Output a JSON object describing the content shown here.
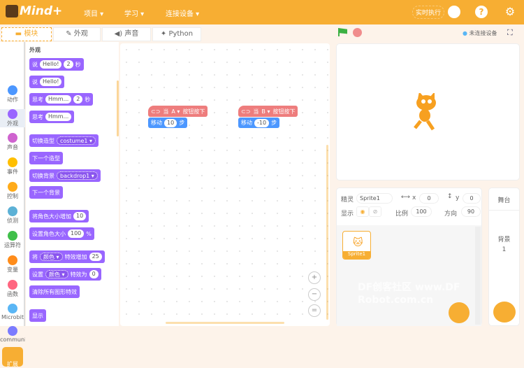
{
  "header": {
    "logo": "Mind+",
    "menus": [
      "项目 ▾",
      "学习 ▾",
      "连接设备 ▾"
    ],
    "realtime": "实时执行",
    "help": "?",
    "settings": "⚙"
  },
  "tabs": [
    "模块",
    "外观",
    "声音",
    "Python"
  ],
  "stage_bar": {
    "device_status": "未连接设备"
  },
  "categories": [
    {
      "label": "动作",
      "color": "#4c97ff"
    },
    {
      "label": "外观",
      "color": "#9966ff"
    },
    {
      "label": "声音",
      "color": "#cf63cf"
    },
    {
      "label": "事件",
      "color": "#ffbf00"
    },
    {
      "label": "控制",
      "color": "#ffab19"
    },
    {
      "label": "侦测",
      "color": "#5cb1d6"
    },
    {
      "label": "运算符",
      "color": "#40bf4a"
    },
    {
      "label": "变量",
      "color": "#ff8c1a"
    },
    {
      "label": "函数",
      "color": "#ff6680"
    },
    {
      "label": "Microbit",
      "color": "#5ab6f5"
    },
    {
      "label": "communi",
      "color": "#7b7bff"
    },
    {
      "label": "扩展",
      "color": "#f7ae33"
    }
  ],
  "palette": {
    "title": "外观",
    "blocks": {
      "say_secs": [
        "说",
        "Hello!",
        "2",
        "秒"
      ],
      "say": [
        "说",
        "Hello!"
      ],
      "think_secs": [
        "思考",
        "Hmm...",
        "2",
        "秒"
      ],
      "think": [
        "思考",
        "Hmm..."
      ],
      "switch_costume": [
        "切换造型",
        "costume1 ▾"
      ],
      "next_costume": "下一个造型",
      "switch_backdrop": [
        "切换背景",
        "backdrop1 ▾"
      ],
      "next_backdrop": "下一个背景",
      "change_size": [
        "将角色大小增加",
        "10"
      ],
      "set_size": [
        "设置角色大小",
        "100",
        "%"
      ],
      "change_effect": [
        "将",
        "颜色 ▾",
        "特效增加",
        "25"
      ],
      "set_effect": [
        "设置",
        "颜色 ▾",
        "特效为",
        "0"
      ],
      "clear_effects": "清除所有图形特效",
      "show": "显示"
    }
  },
  "scripts": [
    {
      "when": "当",
      "key": "A ▾",
      "pressed": "按钮按下",
      "move": "移动",
      "steps": "10",
      "unit": "步"
    },
    {
      "when": "当",
      "key": "B ▾",
      "pressed": "按钮按下",
      "move": "移动",
      "steps": "-10",
      "unit": "步"
    }
  ],
  "sprite_info": {
    "sprite_label": "精灵",
    "sprite_name": "Sprite1",
    "x_label": "x",
    "x": "0",
    "y_label": "y",
    "y": "0",
    "show_label": "显示",
    "size_label": "比例",
    "size": "100",
    "direction_label": "方向",
    "direction": "90",
    "thumb_name": "Sprite1"
  },
  "stage_panel": {
    "title": "舞台",
    "backdrops_label": "背景",
    "backdrops_count": "1"
  },
  "watermark": "DF创客社区 www.DFRobot.com.cn"
}
